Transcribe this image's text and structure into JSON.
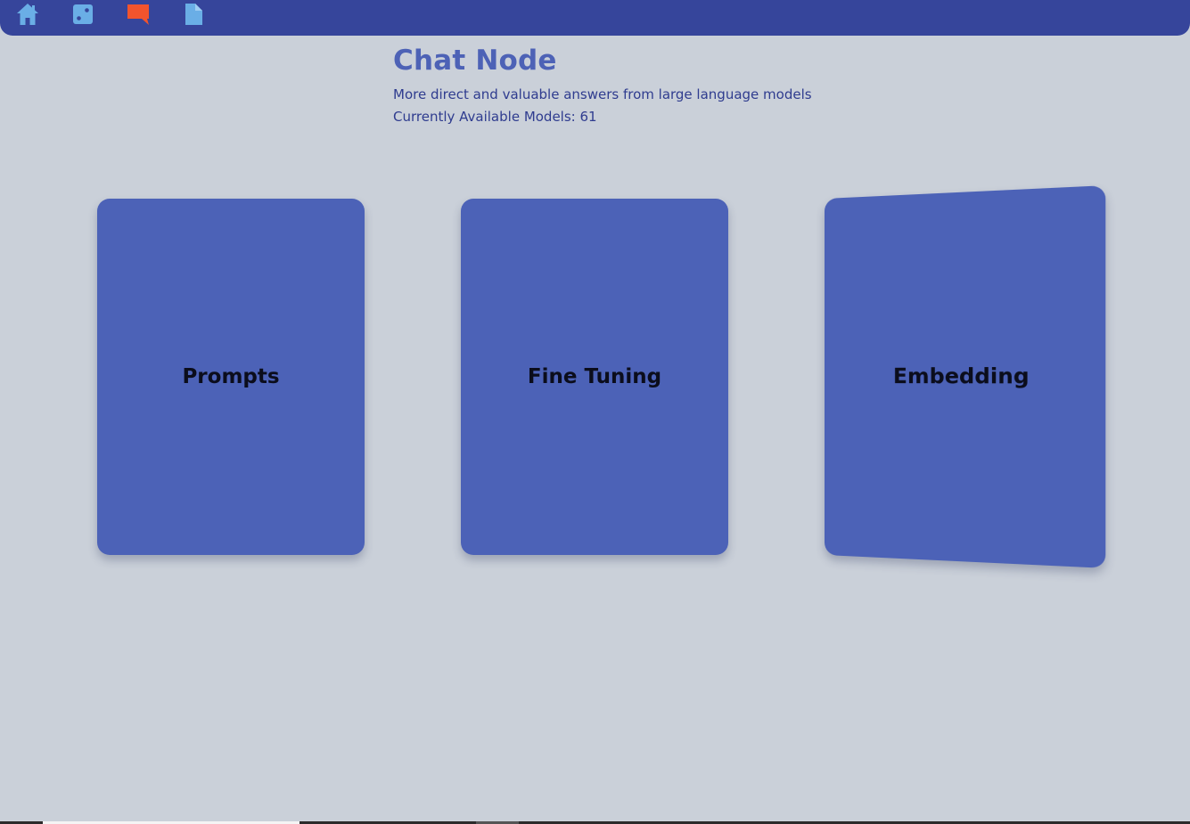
{
  "nav": {
    "items": [
      {
        "icon": "home-icon",
        "color": "#6aaee6"
      },
      {
        "icon": "dice-icon",
        "color": "#6aaee6"
      },
      {
        "icon": "chat-icon",
        "color": "#f2542d"
      },
      {
        "icon": "document-icon",
        "color": "#6aaee6"
      }
    ],
    "background": "#36459b"
  },
  "header": {
    "title": "Chat Node",
    "subtitle": "More direct and valuable answers from large language models",
    "models_label": "Currently Available Models: 61"
  },
  "cards": [
    {
      "label": "Prompts"
    },
    {
      "label": "Fine Tuning"
    },
    {
      "label": "Embedding"
    }
  ],
  "colors": {
    "page_background": "#cad0d9",
    "card_background": "#4c62b7",
    "title": "#4d62b6",
    "text": "#2f3c8f",
    "active_nav": "#f2542d"
  }
}
